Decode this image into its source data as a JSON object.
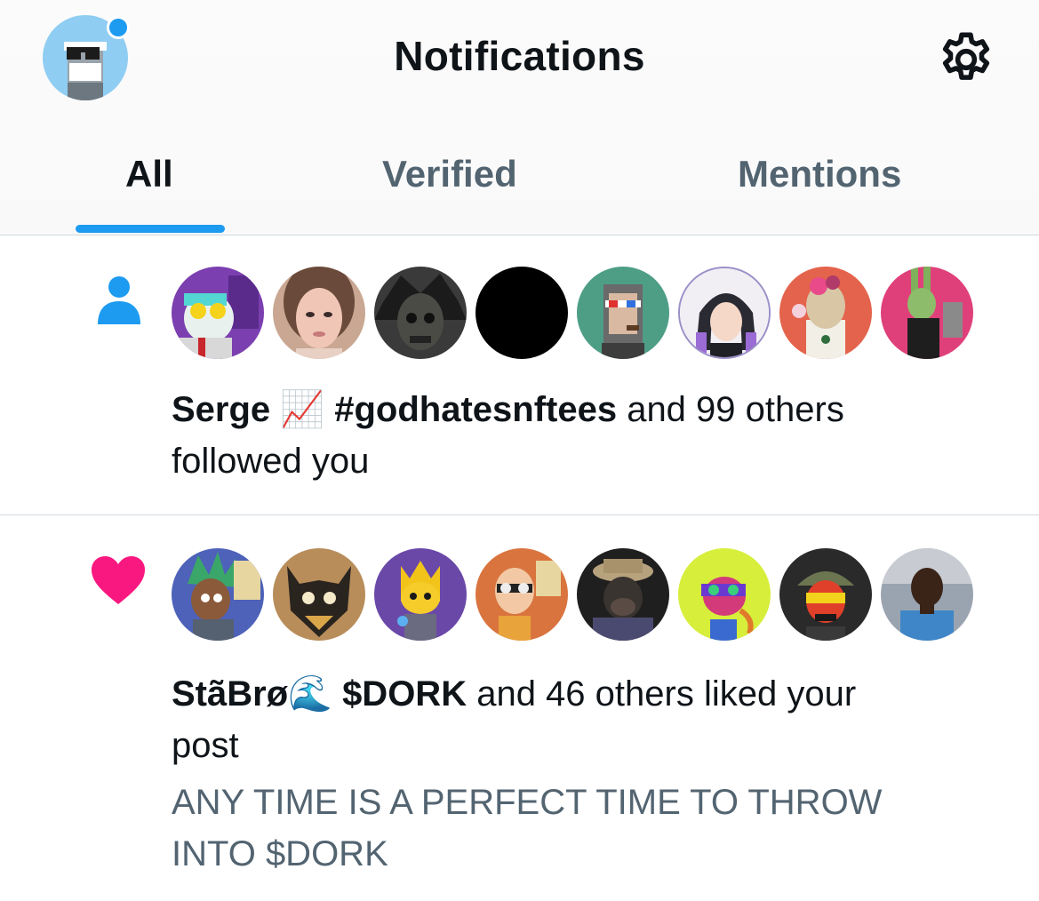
{
  "header": {
    "title": "Notifications",
    "account_icon": "profile-avatar",
    "settings_icon": "gear-icon"
  },
  "tabs": [
    {
      "label": "All",
      "active": true
    },
    {
      "label": "Verified",
      "active": false
    },
    {
      "label": "Mentions",
      "active": false
    }
  ],
  "colors": {
    "accent": "#1d9bf0",
    "like": "#f91880",
    "secondary_text": "#536471",
    "divider": "#cfd9de"
  },
  "notifications": [
    {
      "type": "follow",
      "icon": "person-icon",
      "names": [
        "Serge 📈",
        "#godhatesnftees"
      ],
      "rest": " and 99 others",
      "action": "followed you",
      "avatar_count": 8
    },
    {
      "type": "like",
      "icon": "heart-icon",
      "names": [
        "StãBrø🌊",
        "$DORK"
      ],
      "rest": " and 46 others liked your",
      "action": "post",
      "post_preview": [
        "ANY TIME IS A PERFECT TIME TO THROW",
        "INTO $DORK"
      ],
      "avatar_count": 8
    }
  ]
}
